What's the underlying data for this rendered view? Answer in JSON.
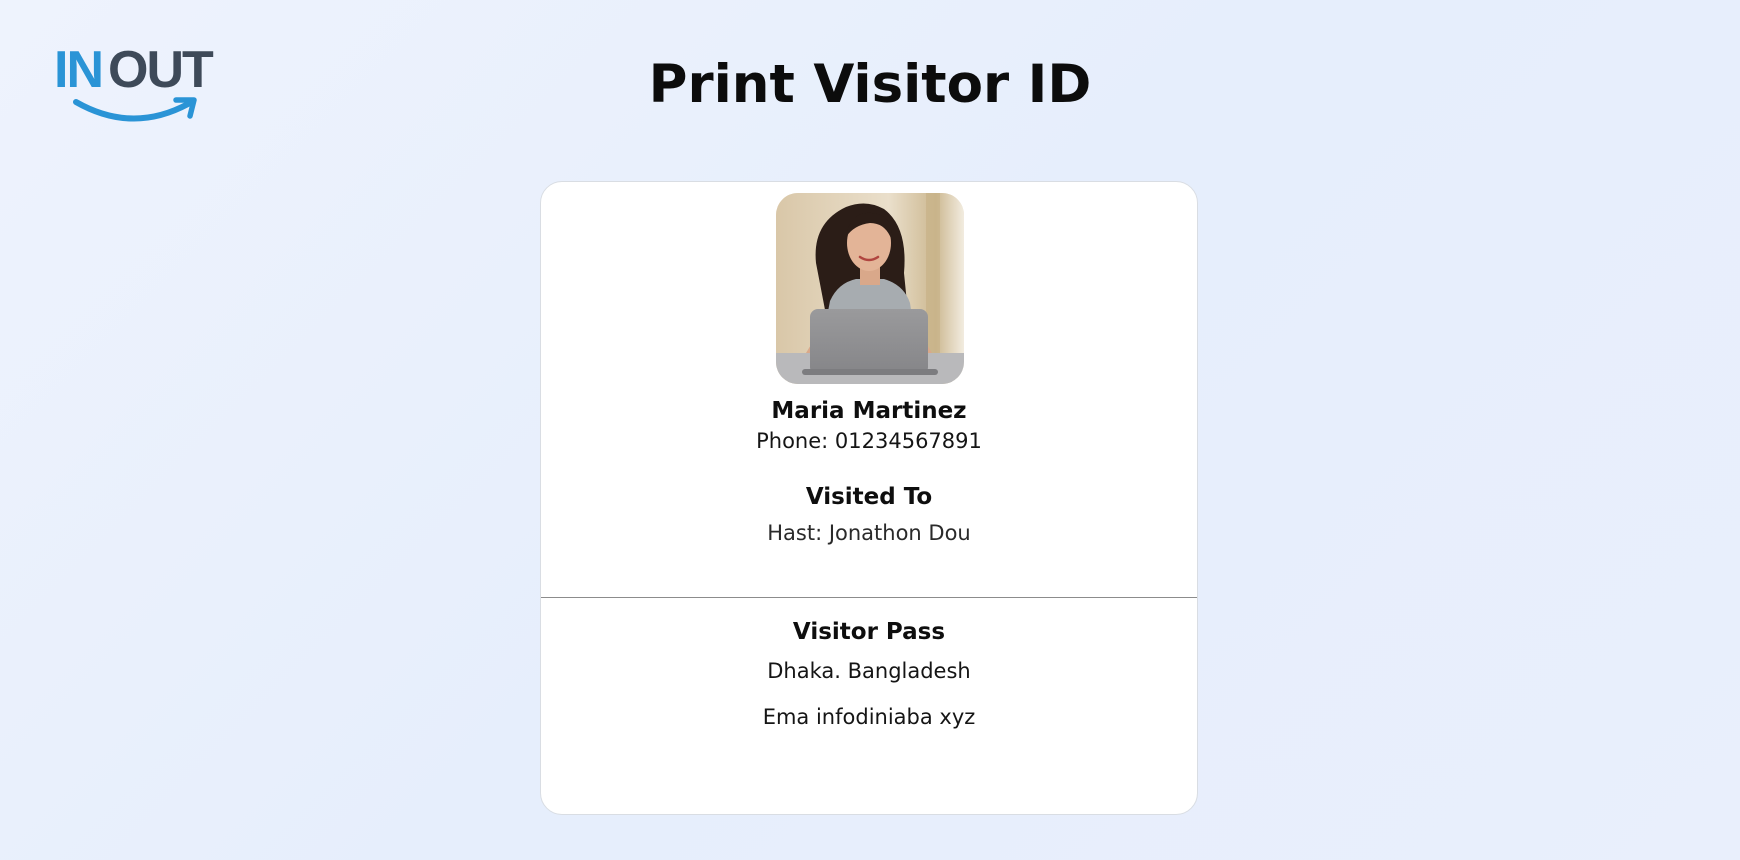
{
  "brand": {
    "logo_in": "IN",
    "logo_out": "OUT",
    "accent_color": "#2a94d6",
    "dark_color": "#3e4a59"
  },
  "page": {
    "title": "Print Visitor ID"
  },
  "visitor": {
    "photo_icon": "visitor-photo",
    "name": "Maria Martinez",
    "phone": "Phone: 01234567891"
  },
  "visit": {
    "heading": "Visited To",
    "host": "Hast: Jonathon Dou"
  },
  "pass": {
    "heading": "Visitor Pass",
    "location": "Dhaka. Bangladesh",
    "company": "Ema infodiniaba xyz"
  }
}
